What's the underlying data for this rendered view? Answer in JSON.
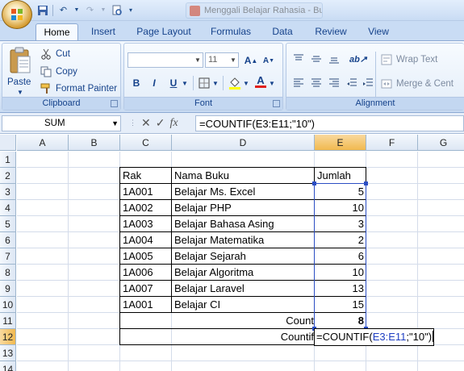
{
  "tabs": [
    "Home",
    "Insert",
    "Page Layout",
    "Formulas",
    "Data",
    "Review",
    "View"
  ],
  "browser_tab_title": "Menggali Belajar Rahasia - Bu...",
  "clipboard": {
    "paste": "Paste",
    "cut": "Cut",
    "copy": "Copy",
    "format_painter": "Format Painter",
    "label": "Clipboard"
  },
  "font": {
    "size": "11",
    "label": "Font"
  },
  "alignment": {
    "wrap_text": "Wrap Text",
    "merge": "Merge & Cent",
    "label": "Alignment"
  },
  "formula_bar": {
    "name_box": "SUM",
    "fx": "fx",
    "formula": "=COUNTIF(E3:E11;\"10\")"
  },
  "columns": [
    "A",
    "B",
    "C",
    "D",
    "E",
    "F",
    "G"
  ],
  "rows": [
    "1",
    "2",
    "3",
    "4",
    "5",
    "6",
    "7",
    "8",
    "9",
    "10",
    "11",
    "12",
    "13",
    "14"
  ],
  "table": {
    "headers": [
      "Rak",
      "Nama Buku",
      "Jumlah"
    ],
    "rows": [
      [
        "1A001",
        "Belajar Ms. Excel",
        "5"
      ],
      [
        "1A002",
        "Belajar PHP",
        "10"
      ],
      [
        "1A003",
        "Belajar Bahasa Asing",
        "3"
      ],
      [
        "1A004",
        "Belajar Matematika",
        "2"
      ],
      [
        "1A005",
        "Belajar Sejarah",
        "6"
      ],
      [
        "1A006",
        "Belajar Algoritma",
        "10"
      ],
      [
        "1A007",
        "Belajar Laravel",
        "13"
      ],
      [
        "1A001",
        "Belajar CI",
        "15"
      ]
    ],
    "count_label": "Count",
    "count_value": "8",
    "countif_label": "Countif"
  },
  "edit_cell": {
    "prefix": "=COUNTIF(",
    "ref": "E3:E11",
    "suffix": ";\"10\")"
  }
}
